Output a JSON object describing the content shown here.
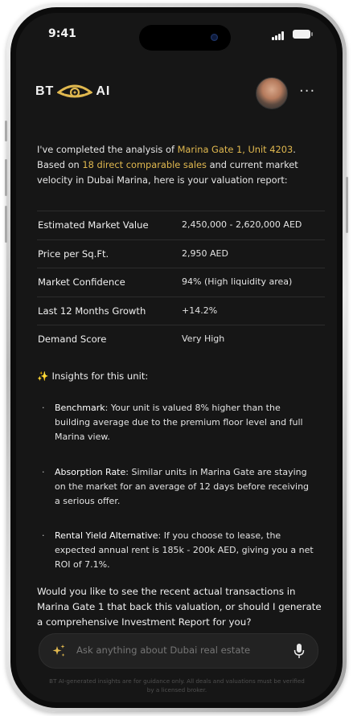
{
  "status_bar": {
    "time": "9:41"
  },
  "header": {
    "logo_left": "BT",
    "logo_right": "AI",
    "more_label": "···"
  },
  "message": {
    "intro_pre": "I've completed the analysis of ",
    "property": "Marina Gate 1, Unit 4203",
    "intro_mid1": ". Based on ",
    "comparables": "18 direct comparable sales",
    "intro_mid2": " and current market velocity in Dubai Marina, here is your valuation report:"
  },
  "report": [
    {
      "label": "Estimated Market Value",
      "value": "2,450,000 - 2,620,000 AED"
    },
    {
      "label": "Price per Sq.Ft.",
      "value": "2,950 AED"
    },
    {
      "label": "Market Confidence",
      "value": "94% (High liquidity area)"
    },
    {
      "label": "Last 12 Months Growth",
      "value": "+14.2%"
    },
    {
      "label": "Demand Score",
      "value": "Very High"
    }
  ],
  "insights": {
    "icon": "sparkles-icon",
    "title": "Insights for this unit:",
    "items": [
      {
        "title": "Benchmark",
        "text": ": Your unit is valued 8% higher than the building average due to the premium floor level and full Marina view."
      },
      {
        "title": "Absorption Rate",
        "text": ": Similar units in Marina Gate are staying on the market for an average of 12 days before receiving a serious offer."
      },
      {
        "title": "Rental Yield Alternative",
        "text": ": If you choose to lease, the expected annual rent is 185k - 200k AED, giving you a net ROI of 7.1%."
      }
    ]
  },
  "question": "Would you like to see the recent actual transactions in Marina Gate 1 that back this valuation, or should I generate a comprehensive Investment Report for you?",
  "input": {
    "placeholder": "Ask anything about Dubai real estate",
    "value": ""
  },
  "disclaimer": "BT AI-generated insights are for guidance only. All deals and valuations must be verified by a licensed broker.",
  "colors": {
    "accent": "#e0b84f",
    "background": "#161616"
  }
}
